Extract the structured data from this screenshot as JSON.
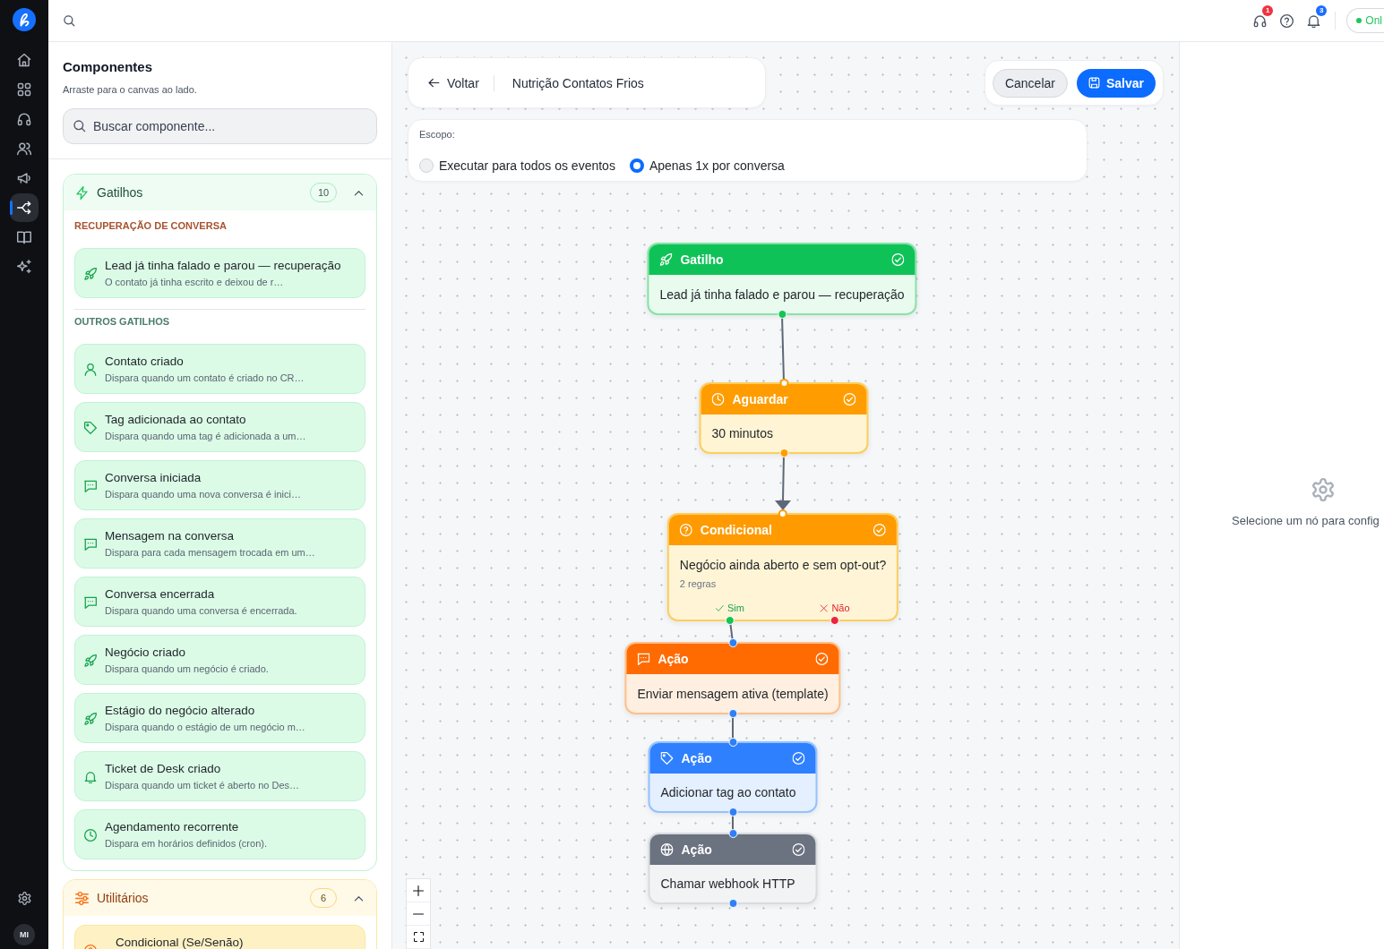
{
  "rail": {
    "items": [
      {
        "kind": "home",
        "selected": false
      },
      {
        "kind": "dashboard",
        "selected": false
      },
      {
        "kind": "support",
        "selected": false
      },
      {
        "kind": "contacts",
        "selected": false
      },
      {
        "kind": "campaigns",
        "selected": false
      },
      {
        "kind": "automations",
        "selected": true
      },
      {
        "kind": "knowledge",
        "selected": false
      },
      {
        "kind": "ai",
        "selected": false
      }
    ],
    "avatar": "MI"
  },
  "top_bar": {
    "buttons": [
      {
        "kind": "support",
        "badge": "1",
        "color": "#ef3340"
      },
      {
        "kind": "help"
      },
      {
        "kind": "notifications",
        "badge": "3",
        "color": "#1a6dff"
      }
    ],
    "status": {
      "label": "Onl",
      "online": true
    }
  },
  "sidebar": {
    "title": "Componentes",
    "subtitle": "Arraste para o canvas ao lado.",
    "search": {
      "placeholder": "Buscar componente..."
    },
    "sections": [
      {
        "kind": "triggers",
        "title": "Gatilhos",
        "count": "10",
        "expanded": true,
        "groups": [
          {
            "heading": "RECUPERAÇÃO DE CONVERSA",
            "color": "#a8532e",
            "items": [
              {
                "kind": "recovery",
                "title": "Lead já tinha falado e parou — recuperação",
                "description": "O contato já tinha escrito e deixou de r…"
              }
            ]
          },
          {
            "heading": "OUTROS GATILHOS",
            "color": "#4b7d6c",
            "items": [
              {
                "kind": "contact",
                "title": "Contato criado",
                "description": "Dispara quando um contato é criado no CR…"
              },
              {
                "kind": "tag",
                "title": "Tag adicionada ao contato",
                "description": "Dispara quando uma tag é adicionada a um…"
              },
              {
                "kind": "conversation",
                "title": "Conversa iniciada",
                "description": "Dispara quando uma nova conversa é inici…"
              },
              {
                "kind": "conversation",
                "title": "Mensagem na conversa",
                "description": "Dispara para cada mensagem trocada em um…"
              },
              {
                "kind": "conversation",
                "title": "Conversa encerrada",
                "description": "Dispara quando uma conversa é encerrada."
              },
              {
                "kind": "deal",
                "title": "Negócio criado",
                "description": "Dispara quando um negócio é criado."
              },
              {
                "kind": "deal",
                "title": "Estágio do negócio alterado",
                "description": "Dispara quando o estágio de um negócio m…"
              },
              {
                "kind": "ticket",
                "title": "Ticket de Desk criado",
                "description": "Dispara quando um ticket é aberto no Des…"
              },
              {
                "kind": "schedule",
                "title": "Agendamento recorrente",
                "description": "Dispara em horários definidos (cron)."
              }
            ]
          }
        ]
      },
      {
        "kind": "utilities",
        "title": "Utilitários",
        "count": "6",
        "expanded": true,
        "groups": [
          {
            "items": [
              {
                "kind": "condition",
                "title": "Condicional (Se/Senão)"
              }
            ]
          }
        ]
      }
    ]
  },
  "editor": {
    "back": "Voltar",
    "flow_name": "Nutrição Contatos Frios",
    "buttons": [
      {
        "kind": "secondary",
        "label": "Cancelar"
      },
      {
        "kind": "primary",
        "label": "Salvar"
      }
    ]
  },
  "scope": {
    "label": "Escopo:",
    "options": [
      {
        "label": "Executar para todos os eventos",
        "selected": false
      },
      {
        "label": "Apenas 1x por conversa",
        "selected": true
      }
    ]
  },
  "nodes": [
    {
      "kind": "trigger",
      "title": "Gatilho",
      "text": "Lead já tinha falado e parou — recuperação",
      "valid": true
    },
    {
      "kind": "wait",
      "title": "Aguardar",
      "text": "30 minutos",
      "valid": true
    },
    {
      "kind": "condition",
      "title": "Condicional",
      "text": "Negócio ainda aberto e sem opt-out?",
      "detail": "2 regras",
      "valid": true,
      "branches": [
        {
          "kind": "yes",
          "label": "Sim"
        },
        {
          "kind": "no",
          "label": "Não"
        }
      ]
    },
    {
      "kind": "message",
      "title": "Ação",
      "text": "Enviar mensagem ativa (template)",
      "valid": true
    },
    {
      "kind": "tag",
      "title": "Ação",
      "text": "Adicionar tag ao contato",
      "valid": true
    },
    {
      "kind": "webhook",
      "title": "Ação",
      "text": "Chamar webhook HTTP",
      "valid": true
    }
  ],
  "edges": [
    {
      "arrow": false
    },
    {
      "arrow": true
    },
    {
      "arrow": false
    },
    {
      "arrow": false
    },
    {
      "arrow": false
    }
  ],
  "inspector": {
    "empty_message": "Selecione um nó para config"
  }
}
